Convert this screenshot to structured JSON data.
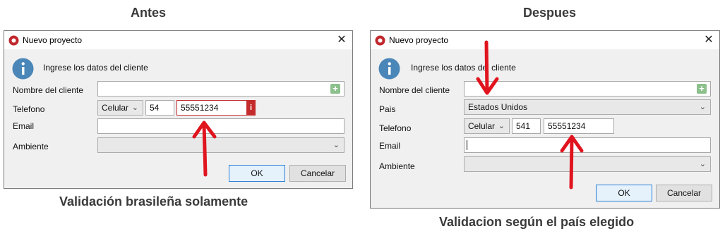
{
  "headings": {
    "before": "Antes",
    "after": "Despues"
  },
  "captions": {
    "before": "Validación brasileña solamente",
    "after": "Validacion según el país elegido"
  },
  "colors": {
    "error": "#c42b2b",
    "arrow": "#e0141e",
    "info": "#4a86b8",
    "add": "#8cc08c"
  },
  "before_dialog": {
    "title": "Nuevo proyecto",
    "close": "✕",
    "info_text": "Ingrese los datos del cliente",
    "labels": {
      "client": "Nombre del cliente",
      "phone": "Telefono",
      "email": "Email",
      "env": "Ambiente"
    },
    "phone": {
      "type": "Celular",
      "code": "54",
      "number": "55551234",
      "error_badge": "i"
    },
    "email_value": "",
    "env_value": "",
    "add_icon": "+",
    "ok": "OK",
    "cancel": "Cancelar"
  },
  "after_dialog": {
    "title": "Nuevo proyecto",
    "close": "✕",
    "info_text": "Ingrese los datos del cliente",
    "labels": {
      "client": "Nombre del cliente",
      "country": "Pais",
      "phone": "Telefono",
      "email": "Email",
      "env": "Ambiente"
    },
    "country_value": "Estados Unidos",
    "phone": {
      "type": "Celular",
      "code": "541",
      "number": "55551234"
    },
    "email_value": "",
    "env_value": "",
    "add_icon": "+",
    "ok": "OK",
    "cancel": "Cancelar"
  }
}
